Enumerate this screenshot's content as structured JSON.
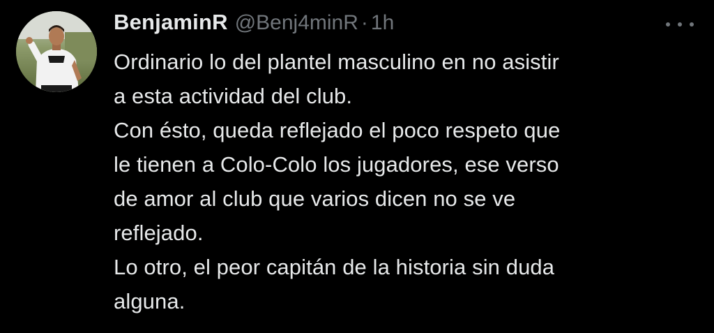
{
  "author": {
    "display_name": "BenjaminR",
    "handle": "@Benj4minR",
    "separator": "·",
    "timestamp": "1h",
    "avatar_icon": "profile-photo-icon"
  },
  "menu": {
    "icon": "more-horizontal-icon"
  },
  "tweet": {
    "lines": [
      "Ordinario lo del plantel masculino en no asistir",
      "a esta actividad del club.",
      "Con ésto, queda reflejado el poco respeto que",
      "le tienen a Colo-Colo los jugadores, ese verso",
      "de amor al club que varios dicen no se ve",
      "reflejado.",
      "Lo otro, el peor capitán de la historia sin duda",
      "alguna."
    ]
  },
  "colors": {
    "background": "#000000",
    "primary_text": "#e7e9ea",
    "secondary_text": "#71767b"
  }
}
